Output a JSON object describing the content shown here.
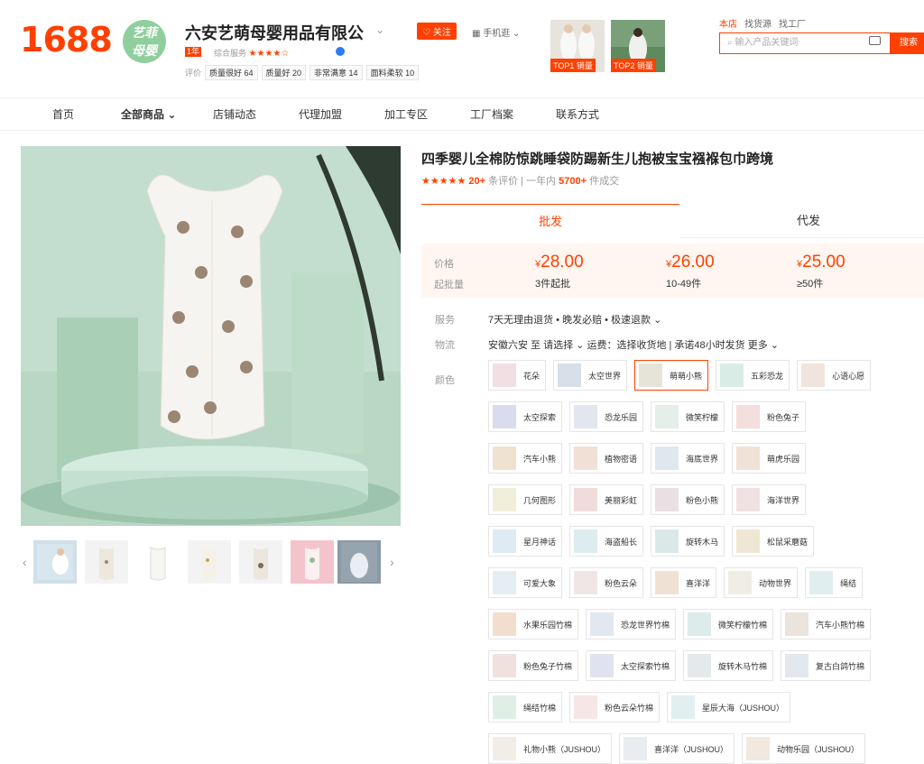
{
  "header": {
    "logo": "1688",
    "shop_badge_line1": "艺菲",
    "shop_badge_line2": "母婴",
    "shop_name": "六安艺萌母婴用品有限公",
    "year_badge": "1年",
    "service_label": "综合服务",
    "service_stars": "★★★★☆",
    "metrics_prefix": "评价",
    "metrics": [
      "质量很好 64",
      "质量好 20",
      "非常满意 14",
      "面料柔软 10"
    ],
    "follow": "♡ 关注",
    "mobile": "▦ 手机逛 ⌄",
    "top_labels": [
      "TOP1 销量",
      "TOP2 销量"
    ],
    "search_tabs": [
      "本店",
      "找货源",
      "找工厂"
    ],
    "search_placeholder": "输入产品关键词",
    "search_button": "搜索"
  },
  "nav": [
    "首页",
    "全部商品 ⌄",
    "店铺动态",
    "代理加盟",
    "加工专区",
    "工厂档案",
    "联系方式"
  ],
  "product": {
    "title": "四季婴儿全棉防惊跳睡袋防踢新生儿抱被宝宝襁褓包巾跨境",
    "stars": "★★★★★",
    "review_count": "20+",
    "review_suffix": "条评价 | 一年内",
    "sales": "5700+",
    "sales_suffix": "件成交",
    "tabs": [
      "批发",
      "代发"
    ],
    "price_label": "价格",
    "qty_label": "起批量",
    "prices": [
      {
        "price": "28.00",
        "qty": "3件起批"
      },
      {
        "price": "26.00",
        "qty": "10-49件"
      },
      {
        "price": "25.00",
        "qty": "≥50件"
      }
    ],
    "currency": "¥",
    "service_label": "服务",
    "service_text": "7天无理由退货 • 晚发必赔 • 极速退款 ⌄",
    "logistics_label": "物流",
    "logistics_text": "安徽六安 至 请选择 ⌄  运费：选择收货地  |  承诺48小时发货  更多 ⌄",
    "color_label": "颜色"
  },
  "colors": [
    [
      "花朵",
      "太空世界",
      "萌萌小熊",
      "五彩恐龙",
      "心语心愿"
    ],
    [
      "太空探索",
      "恐龙乐园",
      "微笑柠檬",
      "粉色兔子"
    ],
    [
      "汽车小熊",
      "植物密语",
      "海底世界",
      "萌虎乐园"
    ],
    [
      "几何图形",
      "美丽彩虹",
      "粉色小熊",
      "海洋世界"
    ],
    [
      "星月神话",
      "海盗船长",
      "旋转木马",
      "松鼠采蘑菇"
    ],
    [
      "可爱大象",
      "粉色云朵",
      "喜洋洋",
      "动物世界",
      "绳结"
    ],
    [
      "水果乐园竹棉",
      "恐龙世界竹棉",
      "微笑柠檬竹棉",
      "汽车小熊竹棉"
    ],
    [
      "粉色兔子竹棉",
      "太空探索竹棉",
      "旋转木马竹棉",
      "复古白鸽竹棉"
    ],
    [
      "绳结竹棉",
      "粉色云朵竹棉",
      "星辰大海（JUSHOU）"
    ],
    [
      "礼物小熊（JUSHOU）",
      "喜洋洋（JUSHOU）",
      "动物乐园（JUSHOU）"
    ]
  ],
  "selected_color": "萌萌小熊"
}
